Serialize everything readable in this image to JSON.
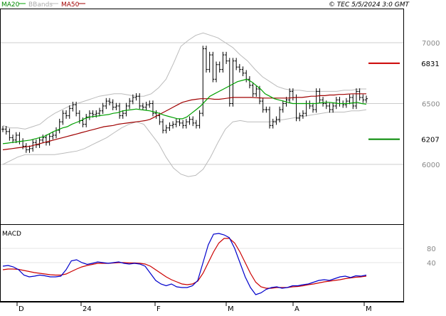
{
  "legend": {
    "ma20": "MA20",
    "bbands": "BBands",
    "ma50": "MA50",
    "source": "© TEC 5/5/2024 3:0 GMT"
  },
  "colors": {
    "ma20": "#00a000",
    "ma50": "#a00000",
    "bbands": "#bbbbbb",
    "candle": "#000000",
    "macd": "#0000cc",
    "signal": "#cc0000",
    "target_high": "#cc0000",
    "target_low": "#008800",
    "grid": "#cccccc"
  },
  "chart_data": [
    {
      "type": "line",
      "name": "price",
      "ylim": [
        5800,
        7200
      ],
      "y_ticks": [
        "7000",
        "6500",
        "6000"
      ],
      "x_ticks": [
        "D",
        "24",
        "F",
        "M",
        "A",
        "M"
      ],
      "levels": [
        {
          "label": "6831",
          "value": 6831,
          "color": "#cc0000"
        },
        {
          "label": "6207",
          "value": 6207,
          "color": "#008800"
        }
      ],
      "ohlc_close": [
        6290,
        6270,
        6220,
        6200,
        6240,
        6190,
        6150,
        6120,
        6130,
        6180,
        6160,
        6200,
        6220,
        6180,
        6230,
        6240,
        6280,
        6350,
        6420,
        6400,
        6460,
        6490,
        6420,
        6360,
        6330,
        6390,
        6420,
        6410,
        6420,
        6440,
        6480,
        6520,
        6510,
        6470,
        6480,
        6400,
        6420,
        6480,
        6520,
        6550,
        6560,
        6480,
        6470,
        6490,
        6500,
        6420,
        6400,
        6350,
        6280,
        6300,
        6320,
        6330,
        6350,
        6340,
        6320,
        6350,
        6370,
        6340,
        6320,
        6420,
        6950,
        6780,
        6900,
        6700,
        6820,
        6780,
        6900,
        6850,
        6500,
        6850,
        6800,
        6780,
        6750,
        6700,
        6650,
        6580,
        6620,
        6520,
        6450,
        6450,
        6320,
        6350,
        6370,
        6450,
        6500,
        6530,
        6600,
        6550,
        6380,
        6400,
        6420,
        6500,
        6480,
        6450,
        6600,
        6530,
        6500,
        6480,
        6450,
        6480,
        6530,
        6500,
        6490,
        6520,
        6550,
        6480,
        6600,
        6550,
        6530,
        6540
      ],
      "ma20": [
        6170,
        6175,
        6180,
        6185,
        6190,
        6195,
        6200,
        6210,
        6220,
        6230,
        6250,
        6270,
        6285,
        6300,
        6310,
        6330,
        6345,
        6360,
        6380,
        6390,
        6395,
        6400,
        6405,
        6410,
        6420,
        6425,
        6440,
        6445,
        6450,
        6455,
        6450,
        6445,
        6440,
        6430,
        6420,
        6405,
        6395,
        6385,
        6375,
        6375,
        6390,
        6420,
        6450,
        6480,
        6520,
        6560,
        6580,
        6600,
        6620,
        6640,
        6660,
        6680,
        6690,
        6700,
        6680,
        6650,
        6620,
        6580,
        6560,
        6540,
        6530,
        6520,
        6510,
        6500,
        6500,
        6500,
        6500,
        6500,
        6500,
        6505,
        6510,
        6510,
        6505,
        6500,
        6500,
        6500,
        6505,
        6510,
        6500,
        6495
      ],
      "ma50": [
        6120,
        6125,
        6130,
        6135,
        6140,
        6145,
        6150,
        6160,
        6170,
        6180,
        6190,
        6200,
        6210,
        6220,
        6230,
        6240,
        6250,
        6260,
        6270,
        6280,
        6290,
        6300,
        6310,
        6315,
        6320,
        6330,
        6335,
        6340,
        6345,
        6350,
        6355,
        6360,
        6370,
        6390,
        6410,
        6430,
        6450,
        6470,
        6490,
        6510,
        6520,
        6530,
        6535,
        6540,
        6540,
        6540,
        6535,
        6535,
        6540,
        6545,
        6550,
        6550,
        6550,
        6550,
        6550,
        6548,
        6546,
        6545,
        6545,
        6545,
        6545,
        6545,
        6545,
        6548,
        6550,
        6550,
        6555,
        6560,
        6560,
        6565,
        6565,
        6570,
        6570,
        6575,
        6575,
        6578,
        6580,
        6580,
        6580,
        6580
      ],
      "bb_upper": [
        6320,
        6300,
        6300,
        6290,
        6310,
        6330,
        6380,
        6420,
        6450,
        6480,
        6500,
        6520,
        6540,
        6560,
        6570,
        6580,
        6580,
        6570,
        6560,
        6560,
        6580,
        6630,
        6700,
        6830,
        6970,
        7020,
        7060,
        7080,
        7060,
        7040,
        7000,
        6960,
        6900,
        6850,
        6780,
        6720,
        6680,
        6640,
        6620,
        6610,
        6610,
        6600,
        6600,
        6600,
        6600,
        6600,
        6610,
        6610,
        6620,
        6620
      ],
      "bb_lower": [
        6000,
        6030,
        6060,
        6080,
        6080,
        6080,
        6080,
        6080,
        6090,
        6100,
        6110,
        6130,
        6160,
        6190,
        6220,
        6260,
        6300,
        6330,
        6350,
        6330,
        6250,
        6170,
        6060,
        5970,
        5920,
        5900,
        5910,
        5960,
        6060,
        6180,
        6290,
        6350,
        6360,
        6350,
        6350,
        6350,
        6350,
        6360,
        6370,
        6380,
        6390,
        6400,
        6410,
        6420,
        6430,
        6430,
        6430,
        6440,
        6440,
        6450
      ]
    },
    {
      "type": "line",
      "name": "MACD",
      "title": "MACD",
      "y_ticks": [
        "80",
        "40"
      ],
      "ylim": [
        -60,
        140
      ],
      "macd": [
        30,
        32,
        28,
        20,
        5,
        0,
        2,
        5,
        3,
        0,
        0,
        2,
        20,
        45,
        48,
        40,
        35,
        38,
        42,
        40,
        38,
        40,
        42,
        38,
        36,
        38,
        36,
        30,
        10,
        -10,
        -20,
        -25,
        -20,
        -28,
        -30,
        -30,
        -25,
        -10,
        40,
        90,
        120,
        122,
        118,
        110,
        80,
        40,
        0,
        -30,
        -50,
        -45,
        -35,
        -30,
        -28,
        -32,
        -30,
        -25,
        -25,
        -22,
        -20,
        -15,
        -10,
        -8,
        -10,
        -5,
        0,
        2,
        -2,
        3,
        2,
        5
      ],
      "signal": [
        20,
        22,
        22,
        21,
        18,
        15,
        12,
        10,
        8,
        6,
        5,
        5,
        8,
        15,
        22,
        28,
        32,
        35,
        38,
        38,
        38,
        39,
        40,
        40,
        39,
        39,
        38,
        36,
        30,
        20,
        10,
        0,
        -8,
        -14,
        -20,
        -22,
        -20,
        -12,
        10,
        40,
        70,
        95,
        108,
        108,
        95,
        70,
        40,
        10,
        -15,
        -28,
        -32,
        -32,
        -30,
        -30,
        -30,
        -28,
        -27,
        -25,
        -22,
        -20,
        -17,
        -14,
        -12,
        -10,
        -8,
        -5,
        -3,
        -1,
        0,
        2
      ]
    }
  ]
}
